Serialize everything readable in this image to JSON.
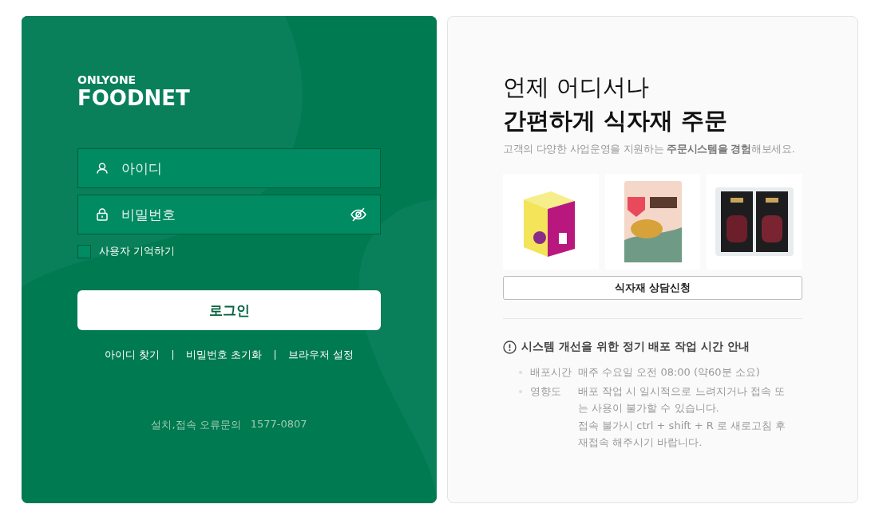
{
  "login": {
    "logo": {
      "top": "ONLYONE",
      "bottom": "FOODNET"
    },
    "fields": [
      {
        "kind": "user",
        "placeholder": "아이디"
      },
      {
        "kind": "password",
        "placeholder": "비밀번호"
      }
    ],
    "remember": {
      "label": "사용자 기억하기",
      "checked": false
    },
    "submit": "로그인",
    "links": [
      "아이디 찾기",
      "비밀번호 초기화",
      "브라우저 설정"
    ],
    "support": {
      "label": "설치,접속 오류문의",
      "phone": "1577-0807"
    }
  },
  "promo": {
    "headline": "언제 어디서나",
    "headline_strong": "간편하게 식자재 주문",
    "subtitle": "고객의 다양한 사업운영을 지원하는 **주문시스템을 경험**해보세요.",
    "products": [
      {
        "kind": "box"
      },
      {
        "kind": "bag"
      },
      {
        "kind": "meat"
      }
    ],
    "consult_button": "식자재 상담신청",
    "notice": {
      "title": "시스템 개선을 위한 정기 배포 작업 시간 안내",
      "items": [
        {
          "label": "배포시간",
          "lines": [
            "매주 수요일 오전 08:00 (약60분 소요)"
          ]
        },
        {
          "label": "영향도",
          "lines": [
            "배포 작업 시 일시적으로 느려지거나 접속 또는 사용이 불가할 수 있습니다.",
            "접속 불가시 ctrl + shift + R 로 새로고침 후 재접속 해주시기 바랍니다."
          ]
        }
      ]
    }
  }
}
